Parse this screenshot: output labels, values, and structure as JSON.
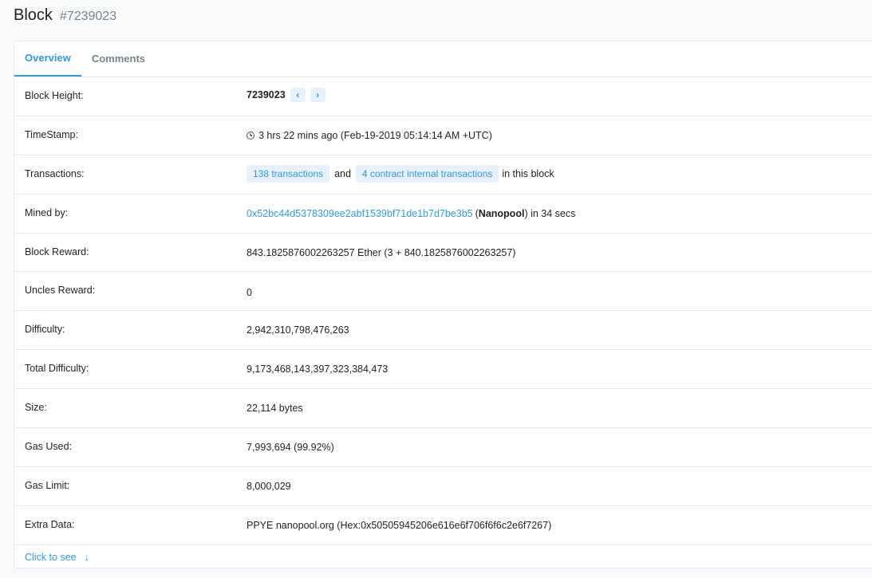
{
  "header": {
    "title": "Block",
    "block_number": "#7239023"
  },
  "tabs": [
    {
      "label": "Overview",
      "active": true
    },
    {
      "label": "Comments",
      "active": false
    }
  ],
  "rows": {
    "block_height": {
      "label": "Block Height:",
      "value": "7239023",
      "prev_icon": "chevron-left-icon",
      "next_icon": "chevron-right-icon"
    },
    "timestamp": {
      "label": "TimeStamp:",
      "value": "3 hrs 22 mins ago (Feb-19-2019 05:14:14 AM +UTC)"
    },
    "transactions": {
      "label": "Transactions:",
      "tx_link": "138 transactions",
      "and_text": "and",
      "internal_link": "4 contract internal transactions",
      "suffix": "in this block"
    },
    "mined_by": {
      "label": "Mined by:",
      "address": "0x52bc44d5378309ee2abf1539bf71de1b7d7be3b5",
      "open_paren": "(",
      "pool": "Nanopool",
      "close_suffix": ") in 34 secs"
    },
    "block_reward": {
      "label": "Block Reward:",
      "value": "843.1825876002263257 Ether (3 + 840.1825876002263257)"
    },
    "uncles_reward": {
      "label": "Uncles Reward:",
      "value": "0"
    },
    "difficulty": {
      "label": "Difficulty:",
      "value": "2,942,310,798,476,263"
    },
    "total_difficulty": {
      "label": "Total Difficulty:",
      "value": "9,173,468,143,397,323,384,473"
    },
    "size": {
      "label": "Size:",
      "value": "22,114 bytes"
    },
    "gas_used": {
      "label": "Gas Used:",
      "value": "7,993,694 (99.92%)"
    },
    "gas_limit": {
      "label": "Gas Limit:",
      "value": "8,000,029"
    },
    "extra_data": {
      "label": "Extra Data:",
      "value": "PPYE nanopool.org (Hex:0x50505945206e616e6f706f6f6c2e6f7267)"
    }
  },
  "footer": {
    "click_to_see": "Click to see",
    "arrow_icon": "arrow-down-icon"
  },
  "colors": {
    "accent": "#3498db",
    "pill_bg": "#e7f1fb",
    "border": "#e7eaf3",
    "muted": "#77838f"
  }
}
